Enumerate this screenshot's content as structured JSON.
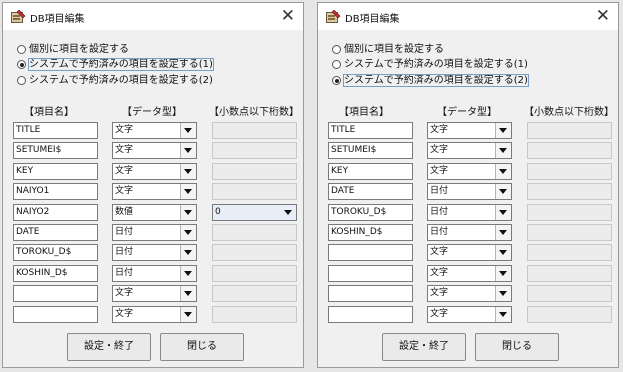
{
  "dialogs": [
    {
      "title": "DB項目編集",
      "close_glyph": "✕",
      "radios": [
        {
          "label": "個別に項目を設定する",
          "selected": false
        },
        {
          "label": "システムで予約済みの項目を設定する(1)",
          "selected": true
        },
        {
          "label": "システムで予約済みの項目を設定する(2)",
          "selected": false
        }
      ],
      "headers": {
        "name": "【項目名】",
        "type": "【データ型】",
        "decimal": "【小数点以下桁数】"
      },
      "rows": [
        {
          "name": "TITLE",
          "type": "文字",
          "decimal": ""
        },
        {
          "name": "SETUMEI$",
          "type": "文字",
          "decimal": ""
        },
        {
          "name": "KEY",
          "type": "文字",
          "decimal": ""
        },
        {
          "name": "NAIYO1",
          "type": "文字",
          "decimal": ""
        },
        {
          "name": "NAIYO2",
          "type": "数値",
          "decimal": "0"
        },
        {
          "name": "DATE",
          "type": "日付",
          "decimal": ""
        },
        {
          "name": "TOROKU_D$",
          "type": "日付",
          "decimal": ""
        },
        {
          "name": "KOSHIN_D$",
          "type": "日付",
          "decimal": ""
        },
        {
          "name": "",
          "type": "文字",
          "decimal": ""
        },
        {
          "name": "",
          "type": "文字",
          "decimal": ""
        }
      ],
      "buttons": {
        "ok": "設定・終了",
        "close": "閉じる"
      }
    },
    {
      "title": "DB項目編集",
      "close_glyph": "✕",
      "radios": [
        {
          "label": "個別に項目を設定する",
          "selected": false
        },
        {
          "label": "システムで予約済みの項目を設定する(1)",
          "selected": false
        },
        {
          "label": "システムで予約済みの項目を設定する(2)",
          "selected": true
        }
      ],
      "headers": {
        "name": "【項目名】",
        "type": "【データ型】",
        "decimal": "【小数点以下桁数】"
      },
      "rows": [
        {
          "name": "TITLE",
          "type": "文字",
          "decimal": ""
        },
        {
          "name": "SETUMEI$",
          "type": "文字",
          "decimal": ""
        },
        {
          "name": "KEY",
          "type": "文字",
          "decimal": ""
        },
        {
          "name": "DATE",
          "type": "日付",
          "decimal": ""
        },
        {
          "name": "TOROKU_D$",
          "type": "日付",
          "decimal": ""
        },
        {
          "name": "KOSHIN_D$",
          "type": "日付",
          "decimal": ""
        },
        {
          "name": "",
          "type": "文字",
          "decimal": ""
        },
        {
          "name": "",
          "type": "文字",
          "decimal": ""
        },
        {
          "name": "",
          "type": "文字",
          "decimal": ""
        },
        {
          "name": "",
          "type": "文字",
          "decimal": ""
        }
      ],
      "buttons": {
        "ok": "設定・終了",
        "close": "閉じる"
      }
    }
  ]
}
